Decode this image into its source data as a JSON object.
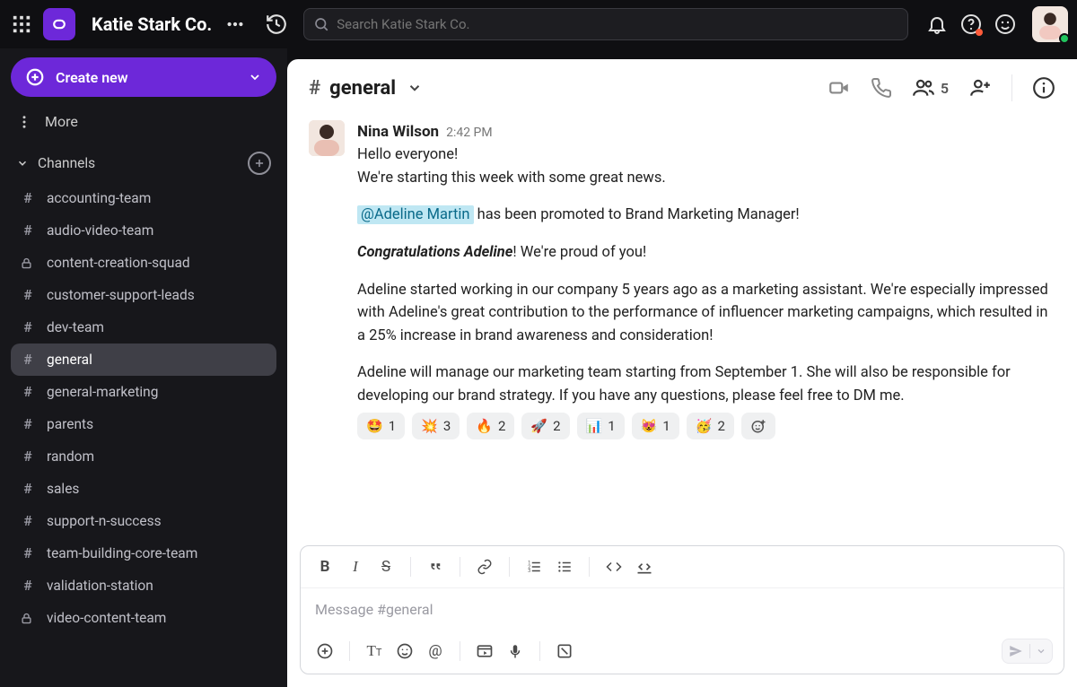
{
  "topbar": {
    "workspace_name": "Katie Stark Co.",
    "search_placeholder": "Search Katie Stark Co."
  },
  "sidebar": {
    "create_label": "Create new",
    "more_label": "More",
    "channels_label": "Channels",
    "channels": [
      {
        "name": "accounting-team",
        "icon": "hash"
      },
      {
        "name": "audio-video-team",
        "icon": "hash"
      },
      {
        "name": "content-creation-squad",
        "icon": "lock"
      },
      {
        "name": "customer-support-leads",
        "icon": "hash"
      },
      {
        "name": "dev-team",
        "icon": "hash"
      },
      {
        "name": "general",
        "icon": "hash",
        "active": true
      },
      {
        "name": "general-marketing",
        "icon": "hash"
      },
      {
        "name": "parents",
        "icon": "hash"
      },
      {
        "name": "random",
        "icon": "hash"
      },
      {
        "name": "sales",
        "icon": "hash"
      },
      {
        "name": "support-n-success",
        "icon": "hash"
      },
      {
        "name": "team-building-core-team",
        "icon": "hash"
      },
      {
        "name": "validation-station",
        "icon": "hash"
      },
      {
        "name": "video-content-team",
        "icon": "lock"
      }
    ]
  },
  "header": {
    "channel_name": "general",
    "member_count": "5"
  },
  "message": {
    "author": "Nina Wilson",
    "time": "2:42 PM",
    "line1": "Hello everyone!",
    "line2": "We're starting this week with some great news.",
    "mention": "@Adeline Martin",
    "line3_tail": " has been promoted to Brand Marketing Manager!",
    "congrats_strong": "Congratulations Adeline",
    "congrats_tail": "! We're proud of you!",
    "para2": "Adeline started working in our company 5 years ago as a marketing assistant. We're especially impressed with Adeline's great contribution to the performance of influencer marketing campaigns, which resulted in a 25% increase in brand awareness and consideration!",
    "para3": "Adeline will manage our marketing team starting from September 1. She will also be responsible for developing our brand strategy. If you have any questions, please feel free to DM me.",
    "reactions": [
      {
        "emoji": "🤩",
        "count": "1"
      },
      {
        "emoji": "💥",
        "count": "3"
      },
      {
        "emoji": "🔥",
        "count": "2"
      },
      {
        "emoji": "🚀",
        "count": "2"
      },
      {
        "emoji": "📊",
        "count": "1"
      },
      {
        "emoji": "😻",
        "count": "1"
      },
      {
        "emoji": "🥳",
        "count": "2"
      }
    ]
  },
  "composer": {
    "placeholder": "Message #general"
  }
}
